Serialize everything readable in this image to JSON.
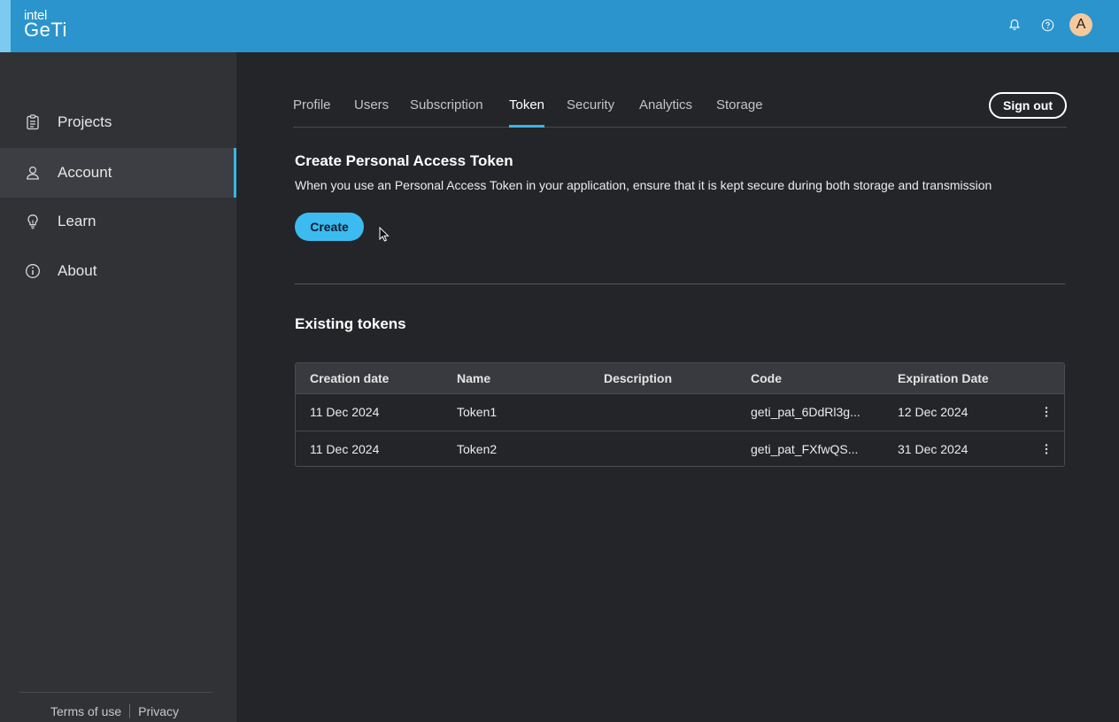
{
  "header": {
    "logo_top": "intel",
    "logo_bottom": "GeTi",
    "avatar_initial": "A",
    "brand_color": "#2b94cc"
  },
  "sidebar": {
    "items": [
      {
        "label": "Projects",
        "icon": "clipboard-icon"
      },
      {
        "label": "Account",
        "icon": "user-icon",
        "active": true
      },
      {
        "label": "Learn",
        "icon": "lightbulb-icon"
      },
      {
        "label": "About",
        "icon": "info-icon"
      }
    ],
    "footer": {
      "terms": "Terms of use",
      "privacy": "Privacy"
    }
  },
  "tabs": [
    {
      "label": "Profile"
    },
    {
      "label": "Users"
    },
    {
      "label": "Subscription"
    },
    {
      "label": "Token",
      "active": true
    },
    {
      "label": "Security"
    },
    {
      "label": "Analytics"
    },
    {
      "label": "Storage"
    }
  ],
  "sign_out_label": "Sign out",
  "create_section": {
    "title": "Create Personal Access Token",
    "description": "When you use an Personal Access Token in your application, ensure that it is kept secure during both storage and transmission",
    "button_label": "Create"
  },
  "existing_section": {
    "title": "Existing tokens",
    "columns": [
      "Creation date",
      "Name",
      "Description",
      "Code",
      "Expiration Date"
    ],
    "rows": [
      {
        "creation_date": "11 Dec 2024",
        "name": "Token1",
        "description": "",
        "code": "geti_pat_6DdRl3g...",
        "expiration_date": "12 Dec 2024"
      },
      {
        "creation_date": "11 Dec 2024",
        "name": "Token2",
        "description": "",
        "code": "geti_pat_FXfwQS...",
        "expiration_date": "31 Dec 2024"
      }
    ]
  },
  "colors": {
    "accent": "#3cb4e8",
    "button": "#3cbbf0",
    "background": "#242528",
    "sidebar": "#313236"
  }
}
